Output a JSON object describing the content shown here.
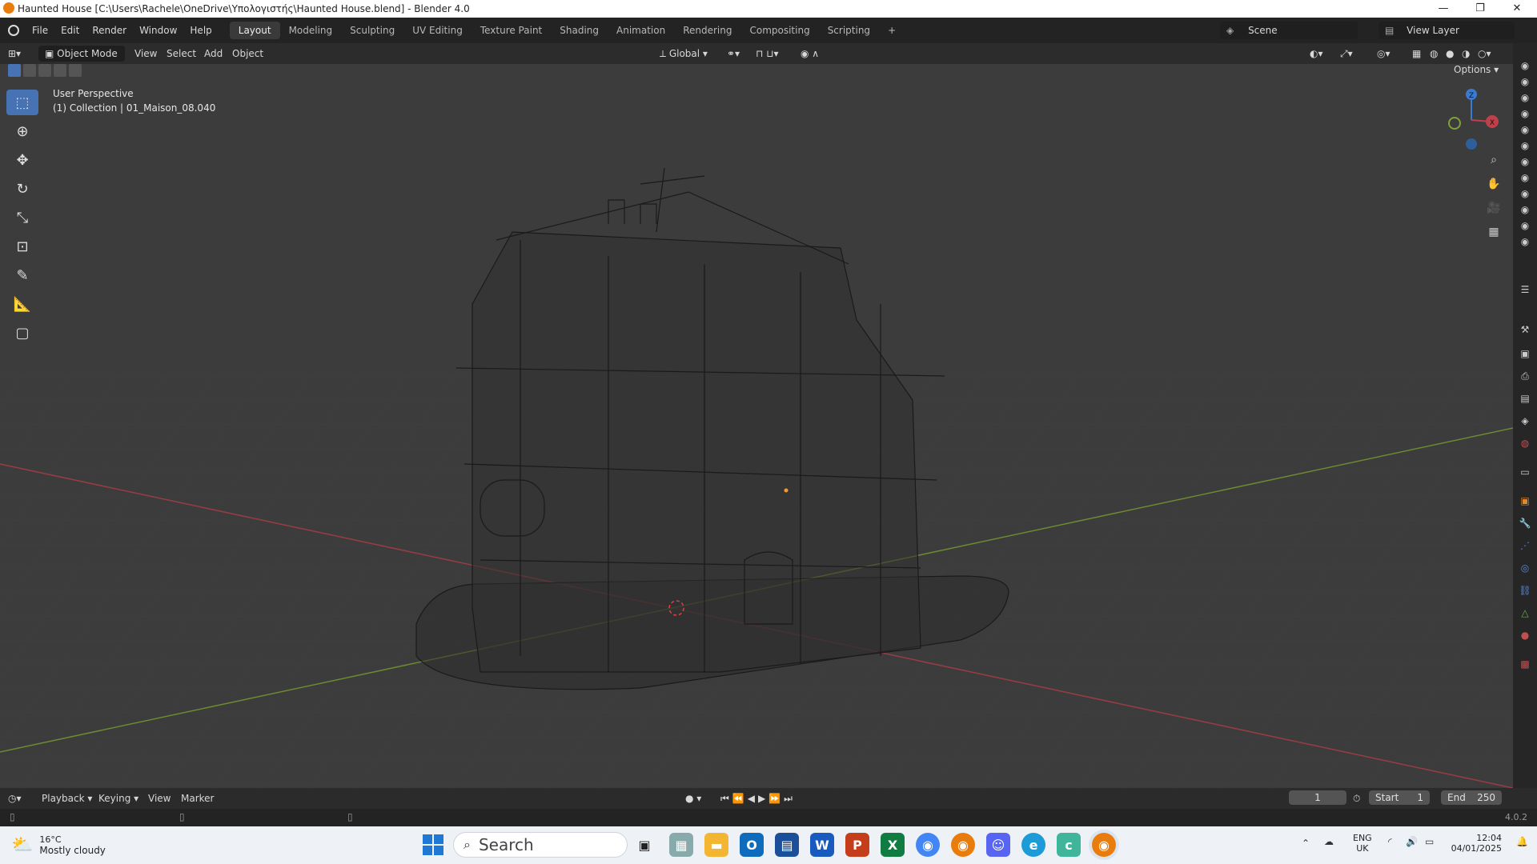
{
  "window": {
    "title": "Haunted House [C:\\Users\\Rachele\\OneDrive\\Υπολογιστής\\Haunted House.blend] - Blender 4.0",
    "minimize": "—",
    "maximize": "❐",
    "close": "✕"
  },
  "menubar": {
    "items": [
      "File",
      "Edit",
      "Render",
      "Window",
      "Help"
    ],
    "workspaces": [
      "Layout",
      "Modeling",
      "Sculpting",
      "UV Editing",
      "Texture Paint",
      "Shading",
      "Animation",
      "Rendering",
      "Compositing",
      "Scripting"
    ],
    "active_workspace": "Layout",
    "add_workspace": "+",
    "scene_label": "Scene",
    "view_layer_label": "View Layer"
  },
  "header": {
    "mode": "Object Mode",
    "menus": [
      "View",
      "Select",
      "Add",
      "Object"
    ],
    "transform_orientation": "Global",
    "options": "Options"
  },
  "viewport": {
    "perspective": "User Perspective",
    "collection": "(1) Collection | 01_Maison_08.040",
    "gizmo": {
      "z": "Z",
      "x": "X"
    }
  },
  "timeline": {
    "menus": [
      "Playback",
      "Keying",
      "View",
      "Marker"
    ],
    "current_frame": "1",
    "start_label": "Start",
    "start_value": "1",
    "end_label": "End",
    "end_value": "250"
  },
  "status": {
    "version": "4.0.2"
  },
  "taskbar": {
    "weather_temp": "16°C",
    "weather_desc": "Mostly cloudy",
    "search_placeholder": "Search",
    "lang_top": "ENG",
    "lang_bottom": "UK",
    "time": "12:04",
    "date": "04/01/2025"
  },
  "colors": {
    "accent": "#4772b3",
    "axis_x": "#c0404a",
    "axis_y": "#7fa03a",
    "axis_z": "#3a7ad0"
  }
}
